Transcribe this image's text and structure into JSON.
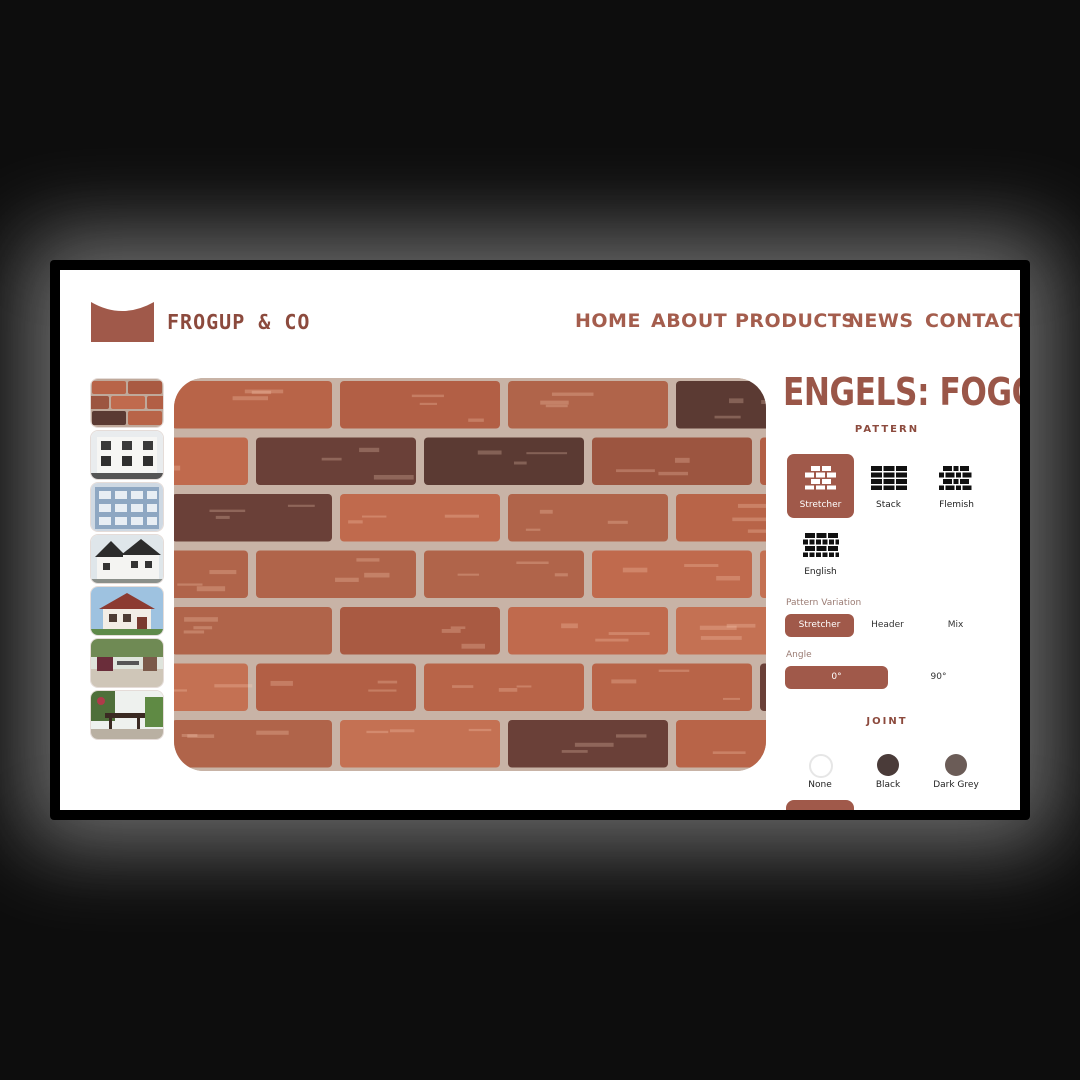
{
  "brand": {
    "name": "FROGUP & CO"
  },
  "nav": {
    "home": "HOME",
    "about": "ABOUT",
    "products": "PRODUCTS",
    "news": "NEWS",
    "contact": "CONTACT"
  },
  "product": {
    "title": "ENGELS: FOGO"
  },
  "pattern": {
    "heading": "PATTERN",
    "options": [
      "Stretcher",
      "Stack",
      "Flemish",
      "English"
    ],
    "selected": "Stretcher"
  },
  "pattern_variation": {
    "label": "Pattern Variation",
    "options": [
      "Stretcher",
      "Header",
      "Mix"
    ],
    "selected": "Stretcher"
  },
  "angle": {
    "label": "Angle",
    "options": [
      "0°",
      "90°"
    ],
    "selected": "0°"
  },
  "joint": {
    "heading": "JOINT",
    "options": [
      {
        "name": "None",
        "color": "#ffffff"
      },
      {
        "name": "Black",
        "color": "#4a3b39"
      },
      {
        "name": "Dark Grey",
        "color": "#6b5c57"
      }
    ]
  },
  "colors": {
    "accent": "#a0594a",
    "brand_text": "#8c4a3d",
    "brick": "#b25f45",
    "mortar": "#c8b3a6"
  },
  "thumbnails": [
    "brick-texture",
    "white-building",
    "blue-apartment",
    "white-house",
    "red-roof-house",
    "patio",
    "garden-terrace"
  ]
}
